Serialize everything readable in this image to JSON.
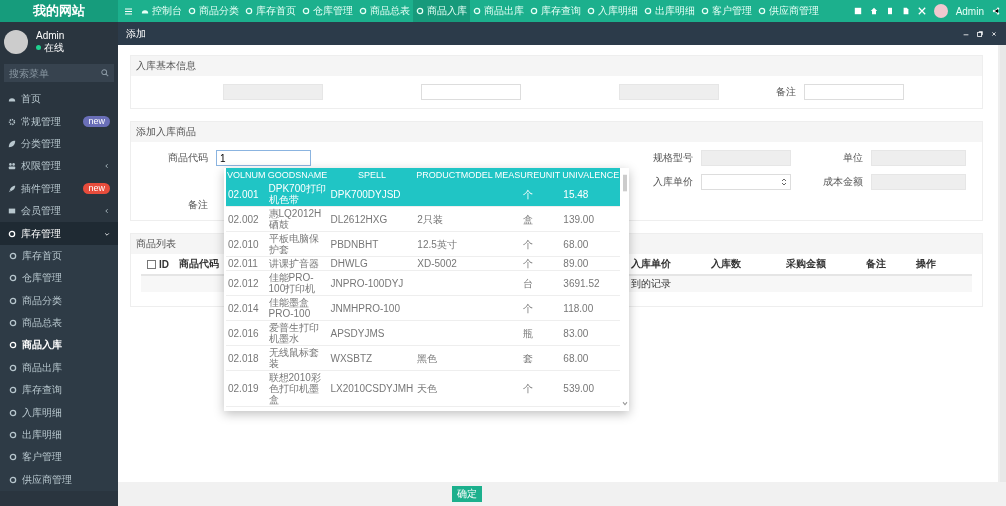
{
  "logo": "我的网站",
  "top_nav": [
    {
      "label": "控制台",
      "selected": false
    },
    {
      "label": "商品分类",
      "selected": false
    },
    {
      "label": "库存首页",
      "selected": false
    },
    {
      "label": "仓库管理",
      "selected": false
    },
    {
      "label": "商品总表",
      "selected": false
    },
    {
      "label": "商品入库",
      "selected": true
    },
    {
      "label": "商品出库",
      "selected": false
    },
    {
      "label": "库存查询",
      "selected": false
    },
    {
      "label": "入库明细",
      "selected": false
    },
    {
      "label": "出库明细",
      "selected": false
    },
    {
      "label": "客户管理",
      "selected": false
    },
    {
      "label": "供应商管理",
      "selected": false
    }
  ],
  "user_menu": {
    "name": "Admin"
  },
  "user": {
    "name": "Admin",
    "status": "在线"
  },
  "sidebar_search": {
    "placeholder": "搜索菜单"
  },
  "sidebar": [
    {
      "label": "首页",
      "selected": false
    },
    {
      "label": "常规管理",
      "selected": false,
      "badge": {
        "text": "new",
        "color": "#6a6fb8"
      }
    },
    {
      "label": "分类管理",
      "selected": false
    },
    {
      "label": "权限管理",
      "selected": false,
      "expanded": false
    },
    {
      "label": "插件管理",
      "selected": false,
      "badge": {
        "text": "new",
        "color": "#e74c3c"
      }
    },
    {
      "label": "会员管理",
      "selected": false,
      "expanded": false
    },
    {
      "label": "库存管理",
      "selected": false,
      "expanded": true,
      "children": [
        {
          "label": "库存首页",
          "selected": false
        },
        {
          "label": "仓库管理",
          "selected": false
        },
        {
          "label": "商品分类",
          "selected": false
        },
        {
          "label": "商品总表",
          "selected": false
        },
        {
          "label": "商品入库",
          "selected": true
        },
        {
          "label": "商品出库",
          "selected": false
        },
        {
          "label": "库存查询",
          "selected": false
        },
        {
          "label": "入库明细",
          "selected": false
        },
        {
          "label": "出库明细",
          "selected": false
        },
        {
          "label": "客户管理",
          "selected": false
        },
        {
          "label": "供应商管理",
          "selected": false
        }
      ]
    }
  ],
  "dialog": {
    "title": "添加",
    "basic": {
      "title": "入库基本信息",
      "remark_label": "备注"
    },
    "add": {
      "title": "添加入库商品",
      "code_label": "商品代码",
      "code_value": "1",
      "remark_label": "备注",
      "spec_label": "规格型号",
      "unit_label": "单位",
      "price_label": "入库单价",
      "cost_label": "成本金额"
    },
    "list": {
      "title": "商品列表",
      "select_all_checked": false,
      "columns": [
        "ID",
        "商品代码",
        "入库单价",
        "入库数",
        "采购金额",
        "备注",
        "操作"
      ],
      "empty": "到的记录"
    },
    "dropdown": {
      "columns": [
        "VOLNUM",
        "GOODSNAME",
        "SPELL",
        "PRODUCTMODEL",
        "MEASUREUNIT",
        "UNIVALENCE"
      ],
      "rows": [
        {
          "selected": true,
          "cells": [
            "02.001",
            "DPK700打印机色带",
            "DPK700DYJSD",
            "",
            "个",
            "15.48"
          ]
        },
        {
          "selected": false,
          "cells": [
            "02.002",
            "惠LQ2012H硒鼓",
            "DL2612HXG",
            "2只装",
            "盒",
            "139.00"
          ]
        },
        {
          "selected": false,
          "cells": [
            "02.010",
            "平板电脑保护套",
            "PBDNBHT",
            "12.5英寸",
            "个",
            "68.00"
          ]
        },
        {
          "selected": false,
          "cells": [
            "02.011",
            "讲课扩音器",
            "DHWLG",
            "XD-5002",
            "个",
            "89.00"
          ]
        },
        {
          "selected": false,
          "cells": [
            "02.012",
            "佳能PRO-100打印机",
            "JNPRO-100DYJ",
            "",
            "台",
            "3691.52"
          ]
        },
        {
          "selected": false,
          "cells": [
            "02.014",
            "佳能墨盒PRO-100",
            "JNMHPRO-100",
            "",
            "个",
            "118.00"
          ]
        },
        {
          "selected": false,
          "cells": [
            "02.016",
            "爱普生打印机墨水",
            "APSDYJMS",
            "",
            "瓶",
            "83.00"
          ]
        },
        {
          "selected": false,
          "cells": [
            "02.018",
            "无线鼠标套装",
            "WXSBTZ",
            "黑色",
            "套",
            "68.00"
          ]
        },
        {
          "selected": false,
          "cells": [
            "02.019",
            "联想2010彩色打印机墨盒",
            "LX2010CSDYJMH",
            "天色",
            "个",
            "539.00"
          ]
        }
      ]
    },
    "confirm": "确定"
  }
}
